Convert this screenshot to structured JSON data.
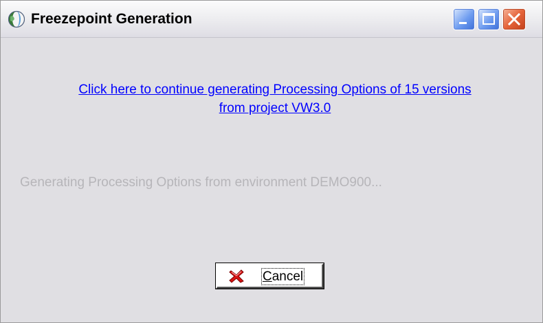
{
  "window": {
    "title": "Freezepoint Generation"
  },
  "titlebar_buttons": {
    "minimize": "minimize-icon",
    "maximize": "maximize-icon",
    "close": "close-icon"
  },
  "content": {
    "link_line1": "Click here to continue generating Processing Options of 15 versions",
    "link_line2": "from project VW3.0",
    "status_text": "Generating Processing Options from environment DEMO900..."
  },
  "cancel_button": {
    "mnemonic": "C",
    "label_rest": "ancel",
    "icon": "red-x-icon"
  },
  "colors": {
    "link": "#0000ff",
    "status_text": "#b6b5b9",
    "window_bg": "#e0dfe3",
    "close_button": "#e5643a"
  }
}
